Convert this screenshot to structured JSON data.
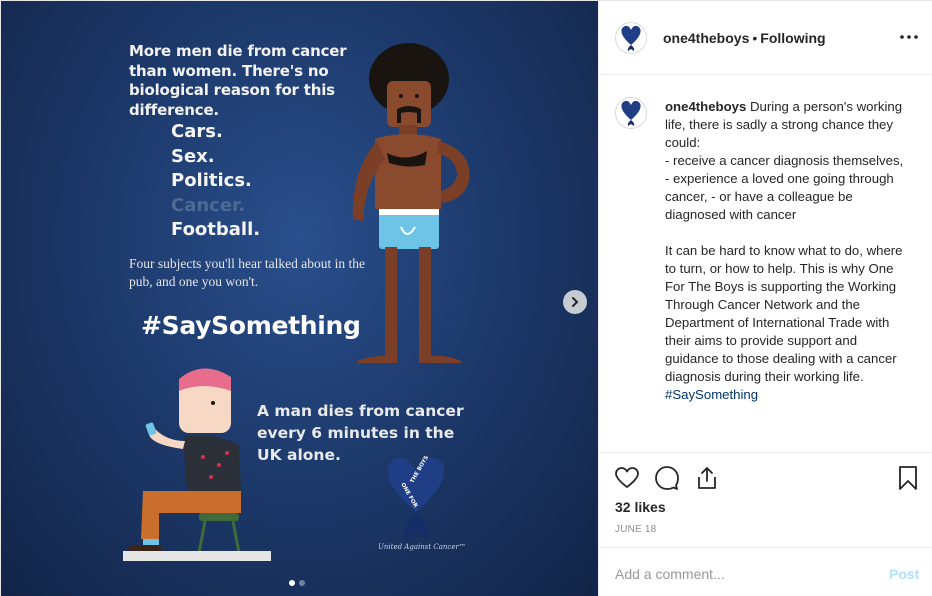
{
  "media": {
    "headline": "More men die from cancer than women. There's no biological reason for this difference.",
    "topics": [
      {
        "text": "Cars.",
        "dim": false
      },
      {
        "text": "Sex.",
        "dim": false
      },
      {
        "text": "Politics.",
        "dim": false
      },
      {
        "text": "Cancer.",
        "dim": true
      },
      {
        "text": "Football.",
        "dim": false
      }
    ],
    "pub_text": "Four subjects you'll hear talked about in the pub, and one you won't.",
    "hashtag": "#SaySomething",
    "stat": "A man dies from cancer every 6 minutes in the UK alone.",
    "logo_text_left": "ONE FOR",
    "logo_text_right": "THE BOYS",
    "logo_caption": "United Against Cancer™",
    "carousel": {
      "count": 2,
      "active": 1
    }
  },
  "header": {
    "username": "one4theboys",
    "separator": "•",
    "follow_status": "Following"
  },
  "caption": {
    "username": "one4theboys",
    "paragraph1": "During a person's working life, there is sadly a strong chance they could:\n- receive a cancer diagnosis themselves,\n- experience a loved one going through cancer, - or have a colleague be diagnosed with cancer",
    "paragraph2": "It can be hard to know what to do, where to turn, or how to help. This is why One For The Boys is supporting the Working Through Cancer Network and the Department of International Trade with their aims to provide support and guidance to those dealing with a cancer diagnosis during their working life.",
    "hashtag": "#SaySomething"
  },
  "actions": {
    "icons": [
      "heart-icon",
      "comment-icon",
      "share-icon",
      "bookmark-icon"
    ]
  },
  "likes": "32 likes",
  "date": "JUNE 18",
  "comment": {
    "placeholder": "Add a comment...",
    "post_label": "Post"
  },
  "colors": {
    "media_bg": "#1d3a6c",
    "link_blue": "#003569",
    "post_disabled": "#b2dffc",
    "muted_text": "#8e8e8e"
  }
}
